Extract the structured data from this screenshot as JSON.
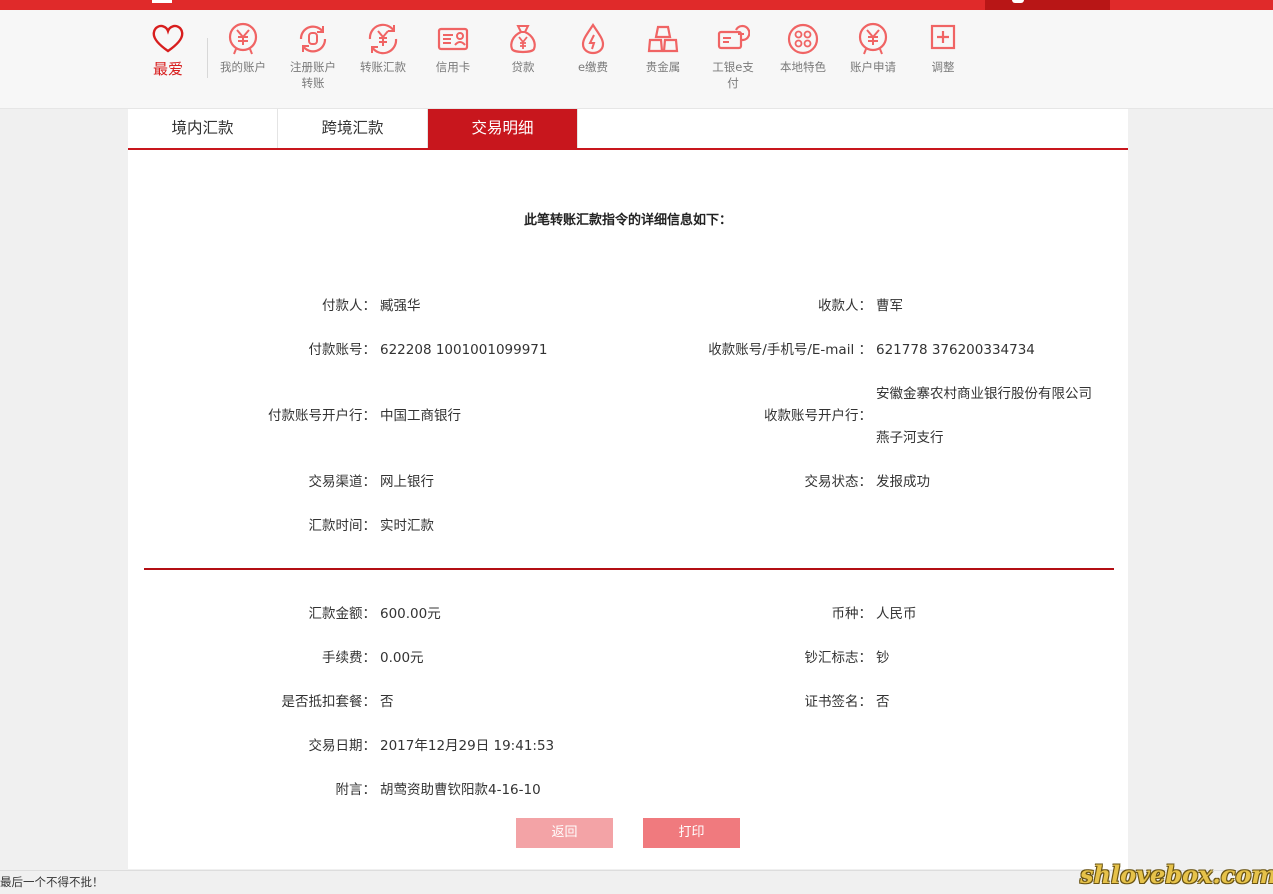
{
  "nav": {
    "favorite": "最爱",
    "items": [
      {
        "label": "我的账户",
        "icon": "yen-circle-icon"
      },
      {
        "label": "注册账户转账",
        "icon": "account-transfer-icon"
      },
      {
        "label": "转账汇款",
        "icon": "transfer-icon"
      },
      {
        "label": "信用卡",
        "icon": "credit-card-icon"
      },
      {
        "label": "贷款",
        "icon": "money-bag-icon"
      },
      {
        "label": "e缴费",
        "icon": "water-drop-icon"
      },
      {
        "label": "贵金属",
        "icon": "gold-bars-icon"
      },
      {
        "label": "工银e支付",
        "icon": "epay-icon"
      },
      {
        "label": "本地特色",
        "icon": "local-dots-icon"
      },
      {
        "label": "账户申请",
        "icon": "account-apply-icon"
      },
      {
        "label": "调整",
        "icon": "plus-box-icon"
      }
    ]
  },
  "tabs": [
    {
      "label": "境内汇款"
    },
    {
      "label": "跨境汇款"
    },
    {
      "label": "交易明细"
    }
  ],
  "heading": "此笔转账汇款指令的详细信息如下：",
  "details": {
    "payer_label": "付款人：",
    "payer": "臧强华",
    "payee_label": "收款人：",
    "payee": "曹军",
    "payer_account_label": "付款账号：",
    "payer_account": "622208 1001001099971",
    "payee_account_label": "收款账号/手机号/E-mail ：",
    "payee_account": "621778 376200334734",
    "payer_bank_label": "付款账号开户行：",
    "payer_bank": "中国工商银行",
    "payee_bank_label": "收款账号开户行：",
    "payee_bank_line1": "安徽金寨农村商业银行股份有限公司",
    "payee_bank_line2": "燕子河支行",
    "channel_label": "交易渠道：",
    "channel": "网上银行",
    "status_label": "交易状态：",
    "status": "发报成功",
    "remit_time_label": "汇款时间：",
    "remit_time": "实时汇款"
  },
  "amounts": {
    "amount_label": "汇款金额：",
    "amount": "600.00元",
    "currency_label": "币种：",
    "currency": "人民币",
    "fee_label": "手续费：",
    "fee": "0.00元",
    "cash_flag_label": "钞汇标志：",
    "cash_flag": "钞",
    "package_label": "是否抵扣套餐：",
    "package": "否",
    "cert_label": "证书签名：",
    "cert": "否",
    "date_label": "交易日期：",
    "date": "2017年12月29日 19:41:53",
    "note_label": "附言：",
    "note": "胡莺资助曹钦阳款4-16-10"
  },
  "buttons": {
    "back": "返回",
    "print": "打印"
  },
  "statusbar": "最后一个不得不批！",
  "watermark": "shlovebox.com",
  "colors": {
    "brand_red": "#c8161d",
    "icon_red": "#f06464"
  }
}
